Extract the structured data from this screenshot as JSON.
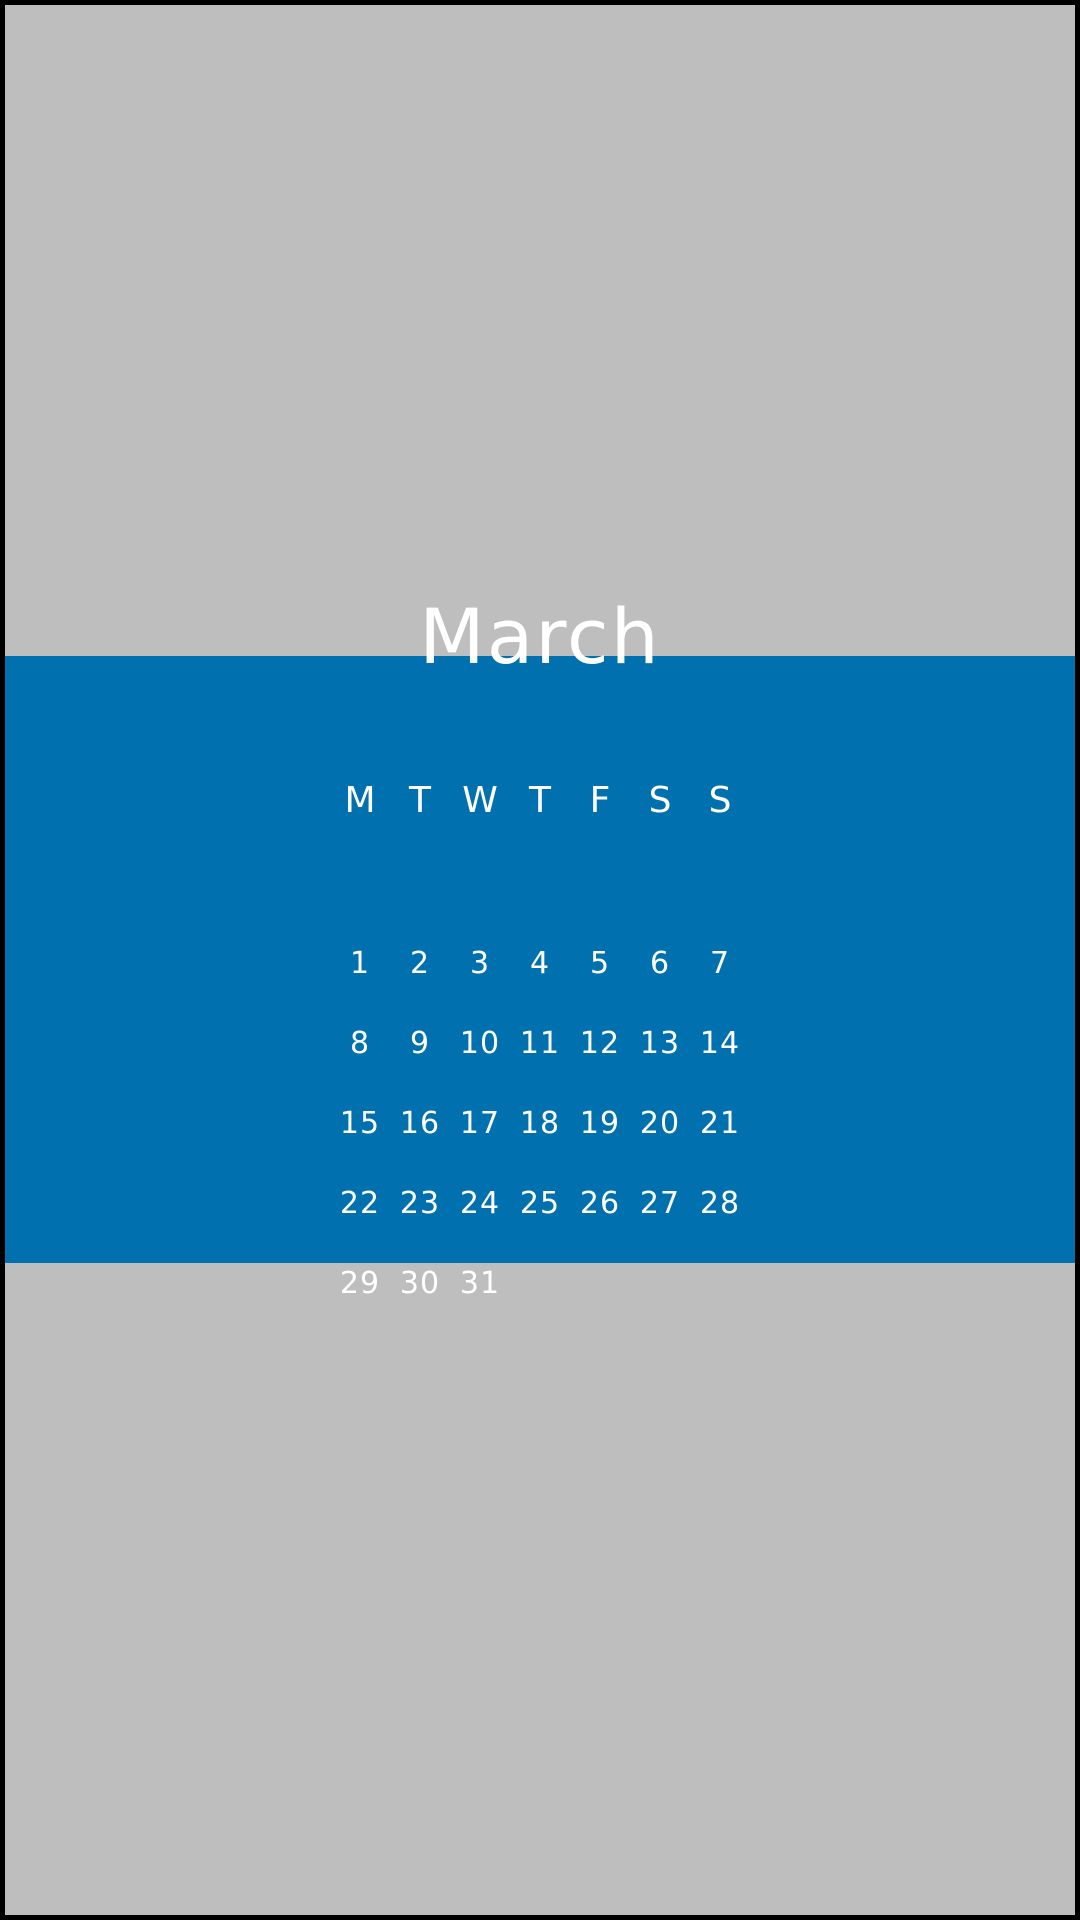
{
  "colors": {
    "background": "#bebebe",
    "band": "#0071ae",
    "text": "#ffffff",
    "frame": "#000000"
  },
  "calendar": {
    "month": "March",
    "weekdays": [
      "M",
      "T",
      "W",
      "T",
      "F",
      "S",
      "S"
    ],
    "first_weekday_index": 0,
    "days_in_month": 31
  }
}
